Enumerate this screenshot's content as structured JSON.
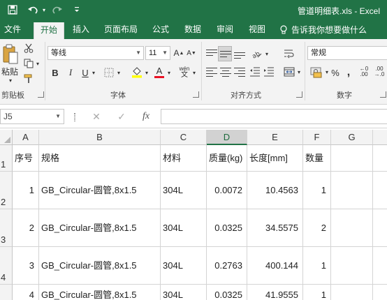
{
  "title": {
    "window_title": "管道明细表.xls - Excel"
  },
  "colors": {
    "accent": "#217346",
    "ribbon_bg": "#f3f3f3",
    "font_color_red": "#e81123",
    "highlight_yellow": "#ffff00"
  },
  "quick_access": {
    "icons": [
      "save-icon",
      "undo-icon",
      "redo-icon",
      "customize-icon"
    ]
  },
  "tabs": [
    {
      "label": "文件",
      "active": false
    },
    {
      "label": "开始",
      "active": true
    },
    {
      "label": "插入",
      "active": false
    },
    {
      "label": "页面布局",
      "active": false
    },
    {
      "label": "公式",
      "active": false
    },
    {
      "label": "数据",
      "active": false
    },
    {
      "label": "审阅",
      "active": false
    },
    {
      "label": "视图",
      "active": false
    }
  ],
  "tell_me": {
    "label": "告诉我你想要做什么"
  },
  "ribbon": {
    "clipboard": {
      "paste_label": "粘贴",
      "group_label": "剪贴板"
    },
    "font": {
      "font_name": "等线",
      "font_size": "11",
      "bold": "B",
      "italic": "I",
      "underline": "U",
      "grow": "A",
      "shrink": "A",
      "font_color_letter": "A",
      "phonetic": "wén",
      "group_label": "字体"
    },
    "alignment": {
      "group_label": "对齐方式"
    },
    "number": {
      "format": "常规",
      "percent": "%",
      "comma": ",",
      "group_label": "数字"
    }
  },
  "formula_bar": {
    "name_box": "J5",
    "cancel": "✕",
    "enter": "✓",
    "fx": "fx",
    "formula": ""
  },
  "grid": {
    "columns": [
      "A",
      "B",
      "C",
      "D",
      "E",
      "F",
      "G"
    ],
    "selected_column": "D",
    "row_numbers": [
      "1",
      "2",
      "3",
      "4"
    ],
    "headers": [
      "序号",
      "规格",
      "材料",
      "质量(kg)",
      "长度[mm]",
      "数量"
    ],
    "rows": [
      [
        "1",
        "GB_Circular-圆管,8x1.5",
        "304L",
        "0.0072",
        "10.4563",
        "1"
      ],
      [
        "2",
        "GB_Circular-圆管,8x1.5",
        "304L",
        "0.0325",
        "34.5575",
        "2"
      ],
      [
        "3",
        "GB_Circular-圆管,8x1.5",
        "304L",
        "0.2763",
        "400.144",
        "1"
      ],
      [
        "4",
        "GB_Circular-圆管,8x1.5",
        "304L",
        "0.0325",
        "41.9555",
        "1"
      ]
    ]
  }
}
